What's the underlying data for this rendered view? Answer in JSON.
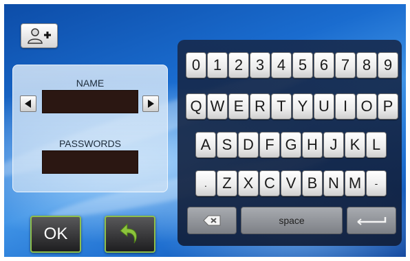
{
  "toolbar": {
    "add_user_icon": "user-add-icon"
  },
  "login": {
    "name_label": "NAME",
    "name_value": "",
    "password_label": "PASSWORDS",
    "password_value": "",
    "prev_icon": "triangle-left-icon",
    "next_icon": "triangle-right-icon"
  },
  "actions": {
    "ok_label": "OK",
    "back_icon": "back-arrow-icon",
    "accent": "#8fbf4a"
  },
  "keyboard": {
    "rows": [
      [
        "0",
        "1",
        "2",
        "3",
        "4",
        "5",
        "6",
        "7",
        "8",
        "9"
      ],
      [
        "Q",
        "W",
        "E",
        "R",
        "T",
        "Y",
        "U",
        "I",
        "O",
        "P"
      ],
      [
        "A",
        "S",
        "D",
        "F",
        "G",
        "H",
        "J",
        "K",
        "L"
      ],
      [
        ".",
        "Z",
        "X",
        "C",
        "V",
        "B",
        "N",
        "M",
        "-"
      ]
    ],
    "backspace_icon": "backspace-icon",
    "space_label": "space",
    "enter_icon": "enter-icon"
  }
}
